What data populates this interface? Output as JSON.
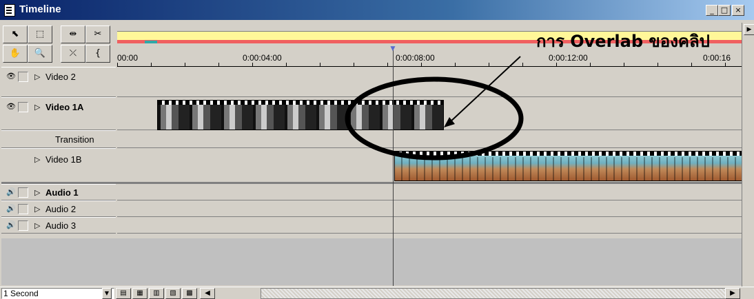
{
  "window": {
    "title": "Timeline",
    "controls": {
      "minimize": "_",
      "maximize": "□",
      "close": "×"
    }
  },
  "tools": [
    {
      "name": "selection-tool-icon",
      "glyph": "⬉"
    },
    {
      "name": "range-select-tool-icon",
      "glyph": "⬚"
    },
    {
      "name": "track-select-tool-icon",
      "glyph": "⇹"
    },
    {
      "name": "razor-tool-icon",
      "glyph": "✂"
    },
    {
      "name": "hand-tool-icon",
      "glyph": "✋"
    },
    {
      "name": "zoom-tool-icon",
      "glyph": "🔍"
    },
    {
      "name": "cross-fade-tool-icon",
      "glyph": "⤫"
    },
    {
      "name": "in-out-point-tool-icon",
      "glyph": "{"
    }
  ],
  "ruler": {
    "labels": [
      "00:00",
      "0:00:04:00",
      "0:00:08:00",
      "0:00:12:00",
      "0:00:16"
    ]
  },
  "tracks": {
    "video2": {
      "label": "Video 2"
    },
    "video1a": {
      "label": "Video 1A"
    },
    "transition": {
      "label": "Transition"
    },
    "video1b": {
      "label": "Video 1B"
    },
    "audio1": {
      "label": "Audio 1"
    },
    "audio2": {
      "label": "Audio 2"
    },
    "audio3": {
      "label": "Audio 3"
    }
  },
  "annotation": {
    "text": "การ Overlab ของคลิป"
  },
  "statusbar": {
    "time_scale": "1 Second"
  },
  "colors": {
    "titlebar": "#0a246a",
    "work_area": "#fff799",
    "render_bar": "#f06060",
    "preview_mark": "#2fa8a8"
  }
}
